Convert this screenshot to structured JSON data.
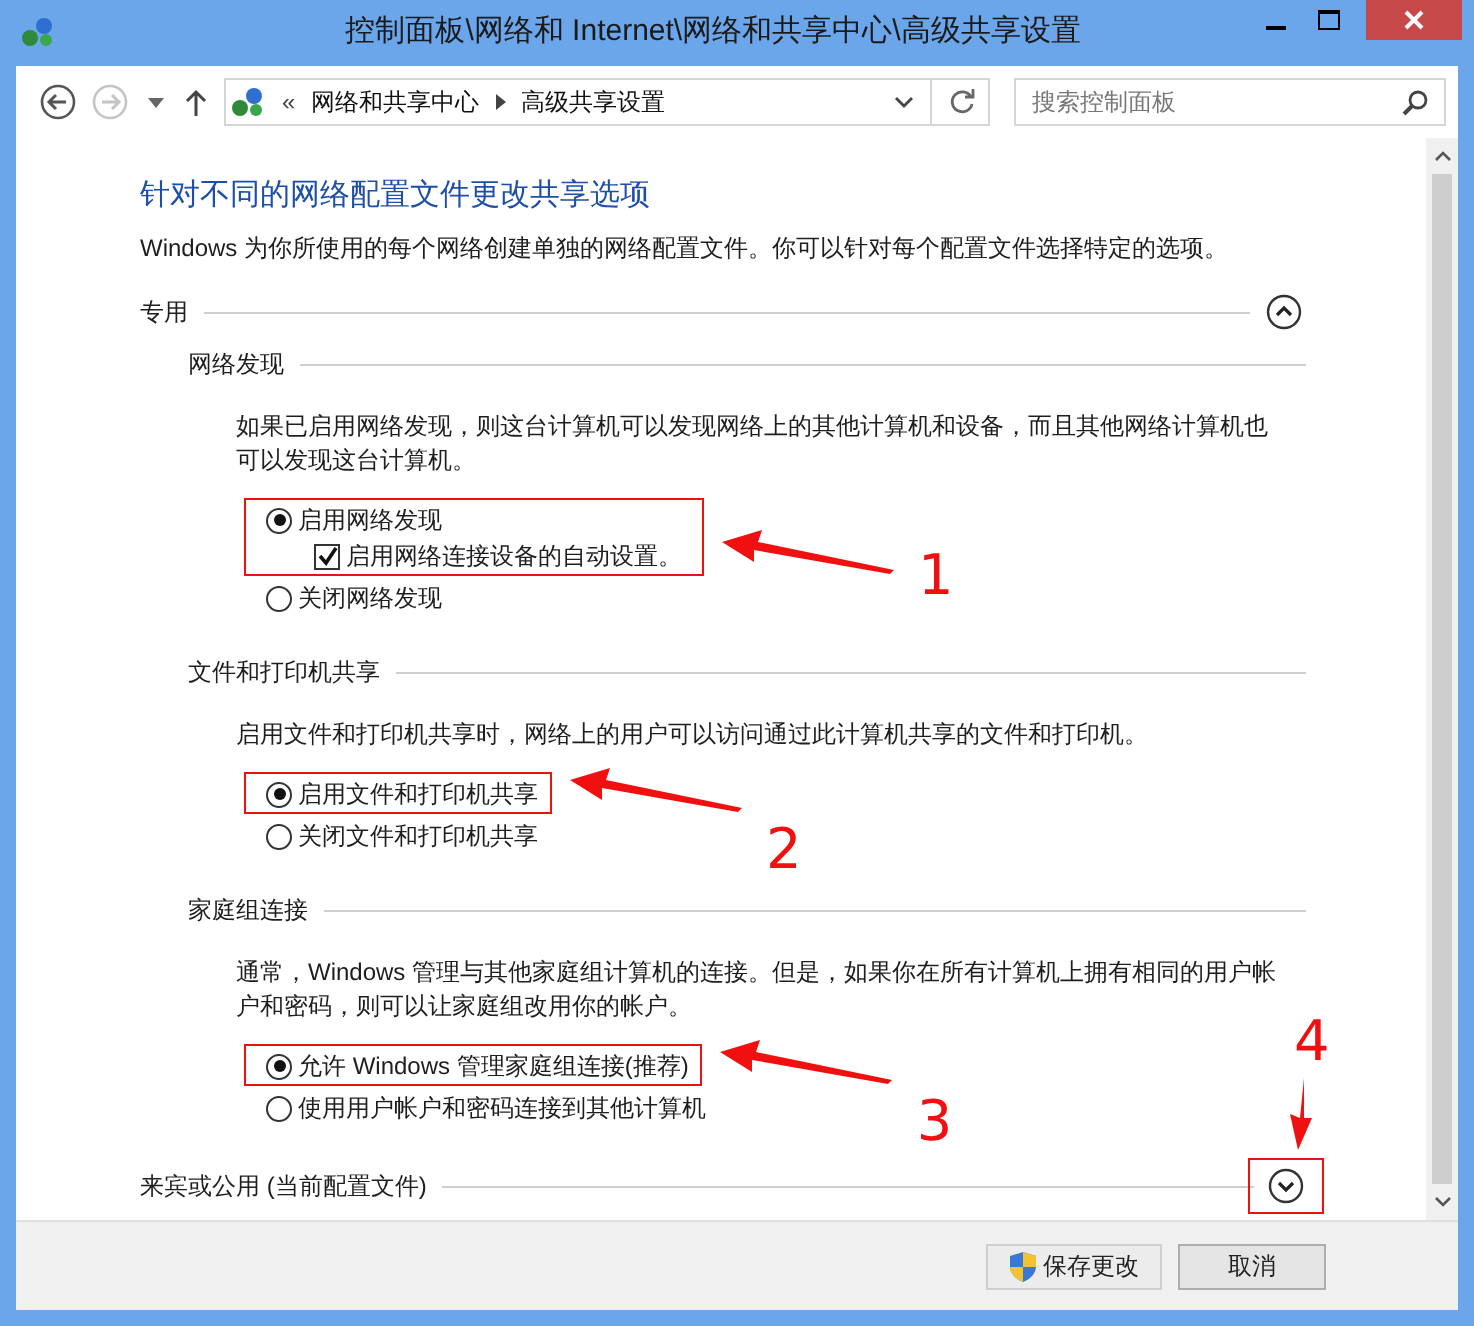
{
  "window": {
    "title": "控制面板\\网络和 Internet\\网络和共享中心\\高级共享设置"
  },
  "address_bar": {
    "overflow": "«",
    "crumbs": [
      {
        "label": "网络和共享中心"
      },
      {
        "label": "高级共享设置"
      }
    ]
  },
  "search": {
    "placeholder": "搜索控制面板"
  },
  "heading": "针对不同的网络配置文件更改共享选项",
  "intro": "Windows 为你所使用的每个网络创建单独的网络配置文件。你可以针对每个配置文件选择特定的选项。",
  "sections": [
    {
      "title": "专用",
      "expanded": true,
      "subsections": [
        {
          "title": "网络发现",
          "description": "如果已启用网络发现，则这台计算机可以发现网络上的其他计算机和设备，而且其他网络计算机也可以发现这台计算机。",
          "options": [
            {
              "kind": "radio",
              "label": "启用网络发现",
              "selected": true,
              "callout": "1",
              "children": [
                {
                  "kind": "checkbox",
                  "label": "启用网络连接设备的自动设置。",
                  "checked": true
                }
              ]
            },
            {
              "kind": "radio",
              "label": "关闭网络发现",
              "selected": false
            }
          ]
        },
        {
          "title": "文件和打印机共享",
          "description": "启用文件和打印机共享时，网络上的用户可以访问通过此计算机共享的文件和打印机。",
          "options": [
            {
              "kind": "radio",
              "label": "启用文件和打印机共享",
              "selected": true,
              "callout": "2"
            },
            {
              "kind": "radio",
              "label": "关闭文件和打印机共享",
              "selected": false
            }
          ]
        },
        {
          "title": "家庭组连接",
          "description": "通常，Windows 管理与其他家庭组计算机的连接。但是，如果你在所有计算机上拥有相同的用户帐户和密码，则可以让家庭组改用你的帐户。",
          "options": [
            {
              "kind": "radio",
              "label": "允许 Windows 管理家庭组连接(推荐)",
              "selected": true,
              "callout": "3"
            },
            {
              "kind": "radio",
              "label": "使用用户帐户和密码连接到其他计算机",
              "selected": false
            }
          ]
        }
      ]
    },
    {
      "title": "来宾或公用 (当前配置文件)",
      "expanded": false,
      "callout": "4"
    }
  ],
  "buttons": [
    {
      "kind": "shield",
      "label": "保存更改"
    },
    {
      "kind": "plain",
      "label": "取消"
    }
  ]
}
